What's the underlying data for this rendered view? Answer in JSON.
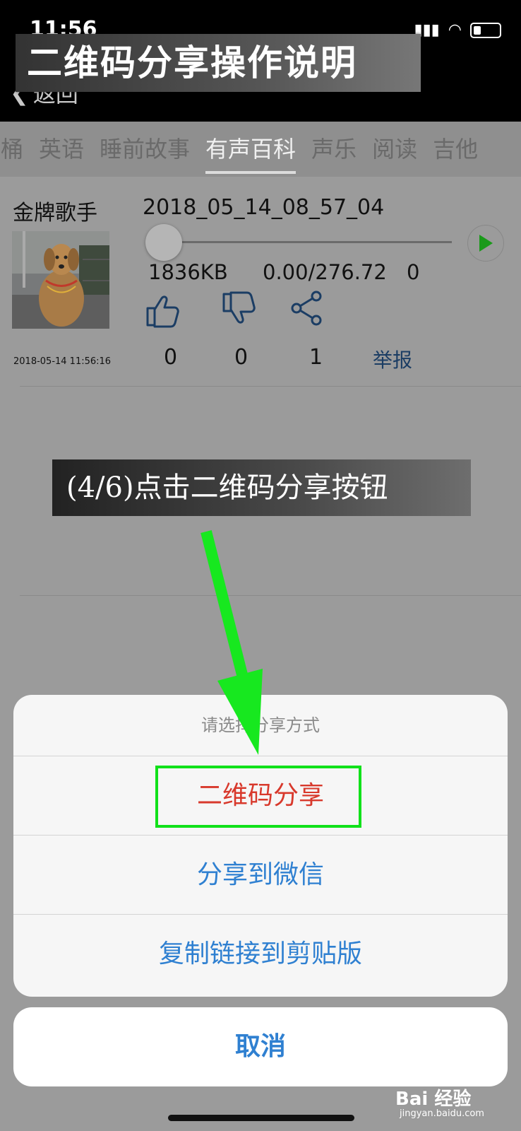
{
  "status": {
    "time": "11:56"
  },
  "nav": {
    "back_label": "返回"
  },
  "banner": {
    "title": "二维码分享操作说明"
  },
  "tabs": [
    {
      "label": "桶"
    },
    {
      "label": "英语"
    },
    {
      "label": "睡前故事"
    },
    {
      "label": "有声百科",
      "active": true
    },
    {
      "label": "声乐"
    },
    {
      "label": "阅读"
    },
    {
      "label": "吉他"
    }
  ],
  "record": {
    "singer": "金牌歌手",
    "name": "2018_05_14_08_57_04",
    "size": "1836KB",
    "time": "0.00/276.72",
    "plays": "0",
    "date": "2018-05-14 11:56:16",
    "likes": "0",
    "dislikes": "0",
    "shares": "1",
    "report": "举报",
    "progress": 0
  },
  "step": {
    "label": "(4/6)点击二维码分享按钮"
  },
  "sheet": {
    "title": "请选择分享方式",
    "options": [
      "二维码分享",
      "分享到微信",
      "复制链接到剪贴版"
    ],
    "cancel": "取消"
  },
  "watermark": {
    "brand": "Bai  经验",
    "site": "jingyan.baidu.com"
  },
  "colors": {
    "highlight": "#11e11a",
    "arrow": "#17e81f",
    "option_red": "#d8392c",
    "option_blue": "#2f80d1"
  }
}
